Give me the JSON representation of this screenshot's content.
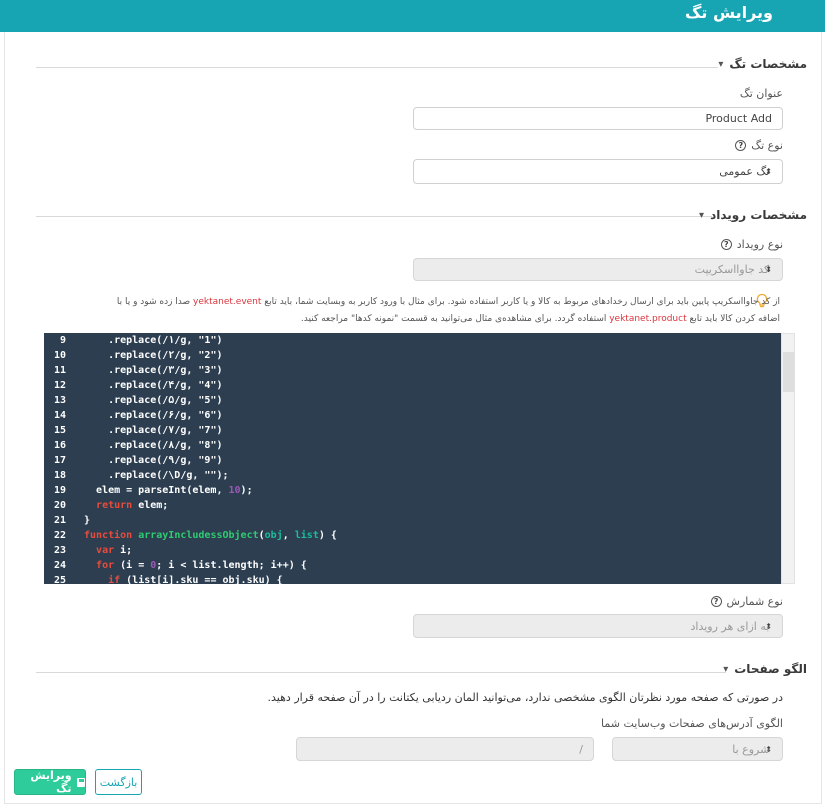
{
  "page": {
    "title": "ویرایش تگ"
  },
  "tag_section": {
    "title": "مشخصات تگ",
    "name_label": "عنوان تگ",
    "name_value": "Product Add",
    "type_label": "نوع تگ",
    "type_value": "تگ عمومی"
  },
  "event_section": {
    "title": "مشخصات رویداد",
    "event_type_label": "نوع رویداد",
    "event_type_value": "کد جاوااسکریپت",
    "info_line1_a": "از کد جاوااسکریپ پایین باید برای ارسال رخدادهای مربوط به کالا و یا کاربر استفاده شود. برای مثال با ورود کاربر به وبسایت شما، باید تابع",
    "info_fn1": "yektanet.event",
    "info_line1_b": "صدا زده شود و یا با",
    "info_line2_a": "اضافه کردن کالا باید تابع",
    "info_fn2": "yektanet.product",
    "info_line2_b": "استفاده گردد. برای مشاهده‌ی مثال می‌توانید به قسمت \"نمونه کدها\" مراجعه کنید.",
    "counting_label": "نوع شمارش",
    "counting_value": "به ازای هر رویداد"
  },
  "code_editor": {
    "lines": [
      {
        "num": "9",
        "text": "    .replace(/١/g, \"1\")"
      },
      {
        "num": "10",
        "text": "    .replace(/٢/g, \"2\")"
      },
      {
        "num": "11",
        "text": "    .replace(/٣/g, \"3\")"
      },
      {
        "num": "12",
        "text": "    .replace(/۴/g, \"4\")"
      },
      {
        "num": "13",
        "text": "    .replace(/۵/g, \"5\")"
      },
      {
        "num": "14",
        "text": "    .replace(/۶/g, \"6\")"
      },
      {
        "num": "15",
        "text": "    .replace(/٧/g, \"7\")"
      },
      {
        "num": "16",
        "text": "    .replace(/٨/g, \"8\")"
      },
      {
        "num": "17",
        "text": "    .replace(/٩/g, \"9\")"
      },
      {
        "num": "18",
        "text": "    .replace(/\\D/g, \"\");"
      },
      {
        "num": "19",
        "text": "  elem = parseInt(elem, 10);"
      },
      {
        "num": "20",
        "text": "  return elem;"
      },
      {
        "num": "21",
        "text": "}"
      },
      {
        "num": "22",
        "text": "function arrayIncludessObject(obj, list) {"
      },
      {
        "num": "23",
        "text": "  var i;"
      },
      {
        "num": "24",
        "text": "  for (i = 0; i < list.length; i++) {"
      },
      {
        "num": "25",
        "text": "    if (list[i].sku == obj.sku) {"
      }
    ]
  },
  "pages_section": {
    "title": "الگو صفحات",
    "description": "در صورتی که صفحه مورد نظرتان الگوی مشخصی ندارد، می‌توانید المان ردیابی یکتانت را در آن صفحه قرار دهید.",
    "pattern_label": "الگوی آدرس‌های صفحات وب‌سایت شما",
    "match_value": "شروع با",
    "url_value": "/"
  },
  "actions": {
    "save_label": "ویرایش تگ",
    "back_label": "بازگشت"
  },
  "colors": {
    "header": "#17a5b4",
    "primary_button": "#2ecc9a",
    "code_bg": "#2c3e50",
    "code_keyword": "#e74c3c",
    "code_function": "#2ecc71",
    "code_number": "#9b59b6",
    "highlight_text": "#d9363e"
  }
}
